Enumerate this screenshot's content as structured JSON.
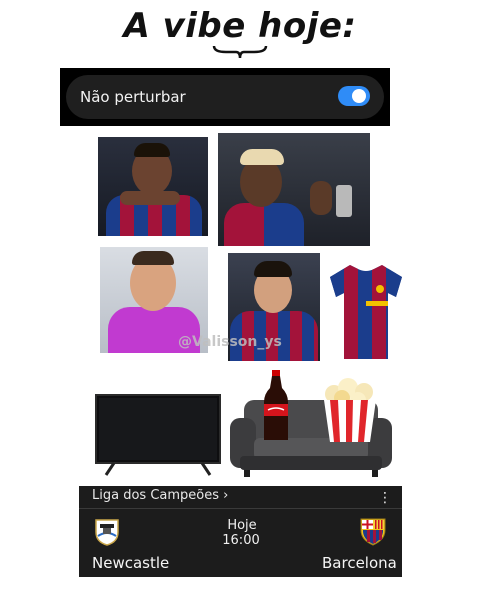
{
  "meme": {
    "title": "A vibe hoje:",
    "watermark": "@Valisson_ys"
  },
  "dnd": {
    "label": "Não perturbar",
    "enabled": true,
    "accent_color": "#2f8cf7"
  },
  "match": {
    "competition": "Liga dos Campeões ›",
    "menu_icon": "more-vert-icon",
    "day": "Hoje",
    "time": "16:00",
    "home": "Newcastle",
    "away": "Barcelona"
  },
  "colors": {
    "barca_blue": "#1b3d8c",
    "barca_red": "#a3133a",
    "card_bg": "#1c1c1c"
  }
}
